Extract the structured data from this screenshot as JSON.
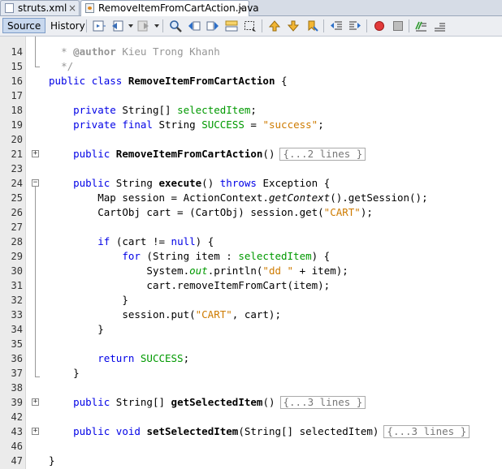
{
  "tabs": [
    {
      "label": "struts.xml",
      "close": "×"
    },
    {
      "label": "RemoveItemFromCartAction.java",
      "close": "×"
    }
  ],
  "toolbar": {
    "source_label": "Source",
    "history_label": "History"
  },
  "colors": {
    "keyword": "#0000e6",
    "string": "#ce7b00",
    "field": "#009900",
    "comment": "#969696"
  },
  "lines": [
    {
      "n": "14",
      "t": "     * @author Kieu Trong Khanh"
    },
    {
      "n": "15",
      "t": "     */"
    },
    {
      "n": "16",
      "t": "    public class RemoveItemFromCartAction {"
    },
    {
      "n": "17",
      "t": ""
    },
    {
      "n": "18",
      "t": "        private String[] selectedItem;"
    },
    {
      "n": "19",
      "t": "        private final String SUCCESS = \"success\";"
    },
    {
      "n": "20",
      "t": ""
    },
    {
      "n": "21",
      "t": "        public RemoveItemFromCartAction() {...2 lines }"
    },
    {
      "n": "23",
      "t": ""
    },
    {
      "n": "24",
      "t": "        public String execute() throws Exception {"
    },
    {
      "n": "25",
      "t": "            Map session = ActionContext.getContext().getSession();"
    },
    {
      "n": "26",
      "t": "            CartObj cart = (CartObj) session.get(\"CART\");"
    },
    {
      "n": "27",
      "t": ""
    },
    {
      "n": "28",
      "t": "            if (cart != null) {"
    },
    {
      "n": "29",
      "t": "                for (String item : selectedItem) {"
    },
    {
      "n": "30",
      "t": "                    System.out.println(\"dd \" + item);"
    },
    {
      "n": "31",
      "t": "                    cart.removeItemFromCart(item);"
    },
    {
      "n": "32",
      "t": "                }"
    },
    {
      "n": "33",
      "t": "                session.put(\"CART\", cart);"
    },
    {
      "n": "34",
      "t": "            }"
    },
    {
      "n": "35",
      "t": ""
    },
    {
      "n": "36",
      "t": "            return SUCCESS;"
    },
    {
      "n": "37",
      "t": "        }"
    },
    {
      "n": "38",
      "t": ""
    },
    {
      "n": "39",
      "t": "        public String[] getSelectedItem() {...3 lines }"
    },
    {
      "n": "42",
      "t": ""
    },
    {
      "n": "43",
      "t": "        public void setSelectedItem(String[] selectedItem) {...3 lines }"
    },
    {
      "n": "46",
      "t": ""
    },
    {
      "n": "47",
      "t": "    }"
    }
  ],
  "code": {
    "l14": {
      "star": "*",
      "tag": "@author",
      "rest": " Kieu Trong Khanh"
    },
    "l15": {
      "end": "*/"
    },
    "l16": {
      "kw1": "public",
      "kw2": "class",
      "name": "RemoveItemFromCartAction",
      "brace": "{"
    },
    "l18": {
      "kw": "private",
      "type": "String[]",
      "field": "selectedItem",
      "semi": ";"
    },
    "l19": {
      "kw1": "private",
      "kw2": "final",
      "type": "String",
      "field": "SUCCESS",
      "eq": "=",
      "str": "\"success\"",
      "semi": ";"
    },
    "l21": {
      "kw": "public",
      "name": "RemoveItemFromCartAction",
      "paren": "()",
      "fold": "{...2 lines }"
    },
    "l24": {
      "kw1": "public",
      "type": "String",
      "name": "execute",
      "paren": "()",
      "kw2": "throws",
      "rest": "Exception {"
    },
    "l25": {
      "a": "Map session = ActionContext.",
      "b": "getContext",
      "c": "().getSession();"
    },
    "l26": {
      "a": "CartObj cart = (CartObj) session.get(",
      "str": "\"CART\"",
      "c": ");"
    },
    "l28": {
      "kw": "if",
      "a": "(cart != ",
      "kw2": "null",
      "c": ") {"
    },
    "l29": {
      "kw": "for",
      "a": "(String item : ",
      "field": "selectedItem",
      "c": ") {"
    },
    "l30": {
      "a": "System.",
      "field": "out",
      "b": ".println(",
      "str": "\"dd \"",
      "c": " + item);"
    },
    "l31": {
      "a": "cart.removeItemFromCart(item);"
    },
    "l32": {
      "a": "}"
    },
    "l33": {
      "a": "session.put(",
      "str": "\"CART\"",
      "c": ", cart);"
    },
    "l34": {
      "a": "}"
    },
    "l36": {
      "kw": "return",
      "field": "SUCCESS",
      "semi": ";"
    },
    "l37": {
      "a": "}"
    },
    "l39": {
      "kw": "public",
      "type": "String[]",
      "name": "getSelectedItem",
      "paren": "()",
      "fold": "{...3 lines }"
    },
    "l43": {
      "kw1": "public",
      "kw2": "void",
      "name": "setSelectedItem",
      "args": "(String[] selectedItem)",
      "fold": "{...3 lines }"
    },
    "l47": {
      "a": "}"
    }
  }
}
